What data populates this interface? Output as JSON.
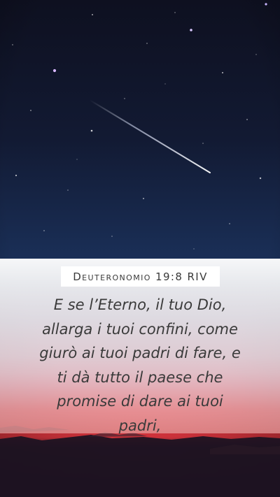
{
  "reference": "Deuteronomio 19:8 RIV",
  "verse_lines": [
    "E se l’Eterno, il tuo Dio,",
    "allarga i tuoi confini, come",
    "giurò ai tuoi padri di fare, e",
    "ti dà tutto il paese che",
    "promise di dare ai tuoi",
    "padri,"
  ],
  "colors": {
    "sky_top": "#0e1020",
    "sky_bottom": "#1a2f57",
    "sunset": "#e2383f",
    "text": "#3a3a3a"
  }
}
